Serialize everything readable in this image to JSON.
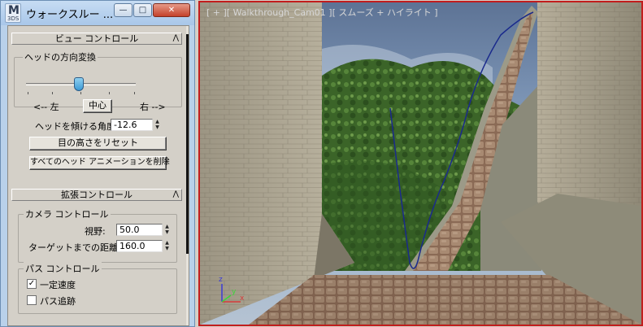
{
  "window": {
    "title": "ウォークスルー ...",
    "logo_main": "M",
    "logo_sub": "3DS",
    "min_glyph": "—",
    "max_glyph": "□",
    "close_glyph": "✕"
  },
  "view_control": {
    "header": "ビュー コントロール",
    "head_turn_group": "ヘッドの方向変換",
    "slider_level": 0.48,
    "left_label": "<-- 左",
    "center_button": "中心",
    "right_label": "右 -->",
    "tilt_label": "ヘッドを傾ける角度",
    "tilt_value": "-12.6",
    "reset_eye_button": "目の高さをリセット",
    "delete_anim_button": "すべてのヘッド アニメーションを削除"
  },
  "extended_control": {
    "header": "拡張コントロール",
    "camera_group": "カメラ コントロール",
    "fov_label": "視野:",
    "fov_value": "50.0",
    "target_dist_label": "ターゲットまでの距離:",
    "target_dist_value": "160.0",
    "path_group": "パス コントロール",
    "constant_speed_label": "一定速度",
    "constant_speed_checked": true,
    "follow_path_label": "パス追跡",
    "follow_path_checked": false
  },
  "viewport": {
    "label": "[ + ][ Walkthrough_Cam01 ][ スムーズ + ハイライト ]",
    "axis_x": "x",
    "axis_y": "y",
    "axis_z": "z",
    "active_border_color": "#c21d1d"
  },
  "colors": {
    "panel_bg": "#d4d0c8",
    "title_bg": "#b9d1ea",
    "sky": "#8aa6c8",
    "stone_wall": "#a8a08b",
    "hills": "#3f6a2c",
    "path": "#1a2a8c"
  }
}
